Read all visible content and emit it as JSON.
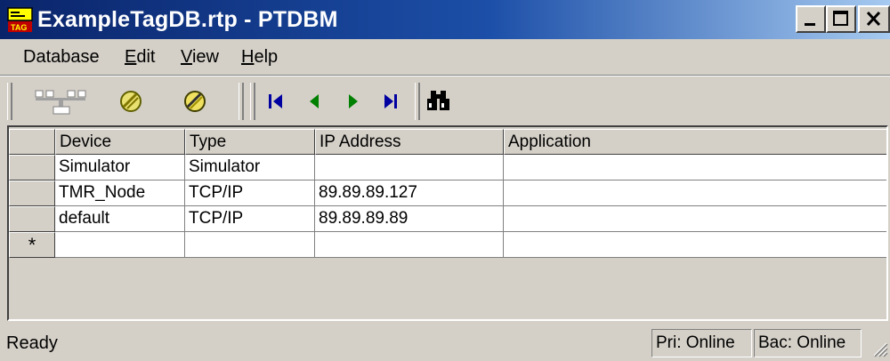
{
  "window": {
    "title": "ExampleTagDB.rtp - PTDBM",
    "icon": "tag-database-icon"
  },
  "menu": [
    {
      "label": "Database",
      "key": "D",
      "rest": "atabase"
    },
    {
      "label": "Edit",
      "key": "E",
      "rest": "dit"
    },
    {
      "label": "View",
      "key": "V",
      "rest": "iew"
    },
    {
      "label": "Help",
      "key": "H",
      "rest": "elp"
    }
  ],
  "toolbar": {
    "buttons": [
      "network-icon",
      "disconnect-icon",
      "connect-icon",
      "first-record-icon",
      "previous-record-icon",
      "next-record-icon",
      "last-record-icon",
      "find-binoculars-icon"
    ]
  },
  "grid": {
    "columns": [
      "Device",
      "Type",
      "IP Address",
      "Application"
    ],
    "rows": [
      [
        "Simulator",
        "Simulator",
        "",
        ""
      ],
      [
        "TMR_Node",
        "TCP/IP",
        "89.89.89.127",
        ""
      ],
      [
        "default",
        "TCP/IP",
        "89.89.89.89",
        ""
      ]
    ],
    "new_row_marker": "*"
  },
  "status": {
    "text": "Ready",
    "primary": "Pri: Online",
    "backup": "Bac: Online"
  },
  "colors": {
    "titlebar_start": "#0a246a",
    "titlebar_end": "#a6caf0",
    "face": "#d4d0c8",
    "nav_blue": "#0000a0",
    "nav_green": "#008000"
  }
}
